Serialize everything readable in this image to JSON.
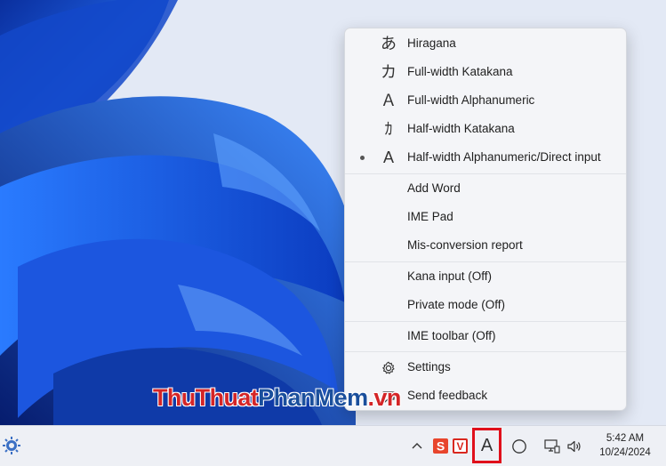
{
  "ime_menu": {
    "items": [
      {
        "id": "hiragana",
        "icon": "あ",
        "label": "Hiragana",
        "selected": false
      },
      {
        "id": "full-katakana",
        "icon": "カ",
        "label": "Full-width Katakana",
        "selected": false
      },
      {
        "id": "full-alnum",
        "icon": "Ａ",
        "label": "Full-width Alphanumeric",
        "selected": false
      },
      {
        "id": "half-katakana",
        "icon": "ｶ",
        "label": "Half-width Katakana",
        "selected": false
      },
      {
        "id": "half-alnum",
        "icon": "A",
        "label": "Half-width Alphanumeric/Direct input",
        "selected": true
      },
      {
        "id": "add-word",
        "icon": "",
        "label": "Add Word"
      },
      {
        "id": "ime-pad",
        "icon": "",
        "label": "IME Pad"
      },
      {
        "id": "mis-conversion",
        "icon": "",
        "label": "Mis-conversion report"
      },
      {
        "id": "kana-input",
        "icon": "",
        "label": "Kana input (Off)"
      },
      {
        "id": "private-mode",
        "icon": "",
        "label": "Private mode (Off)"
      },
      {
        "id": "ime-toolbar",
        "icon": "",
        "label": "IME toolbar (Off)"
      },
      {
        "id": "settings",
        "icon": "gear-icon",
        "label": "Settings"
      },
      {
        "id": "send-feedback",
        "icon": "feedback-icon",
        "label": "Send feedback"
      }
    ]
  },
  "watermark": {
    "part1": "ThuThuat",
    "part2": "PhanMem",
    "part3": ".vn"
  },
  "taskbar": {
    "ime_indicator": "A",
    "clock_time": "5:42 AM",
    "clock_date": "10/24/2024",
    "tray_icons": [
      "chevron-up-icon",
      "s-app-icon",
      "v-app-icon",
      "ime-mode-icon",
      "ime-status-icon",
      "network-icon",
      "volume-icon"
    ],
    "accent_red": "#e0101b"
  }
}
